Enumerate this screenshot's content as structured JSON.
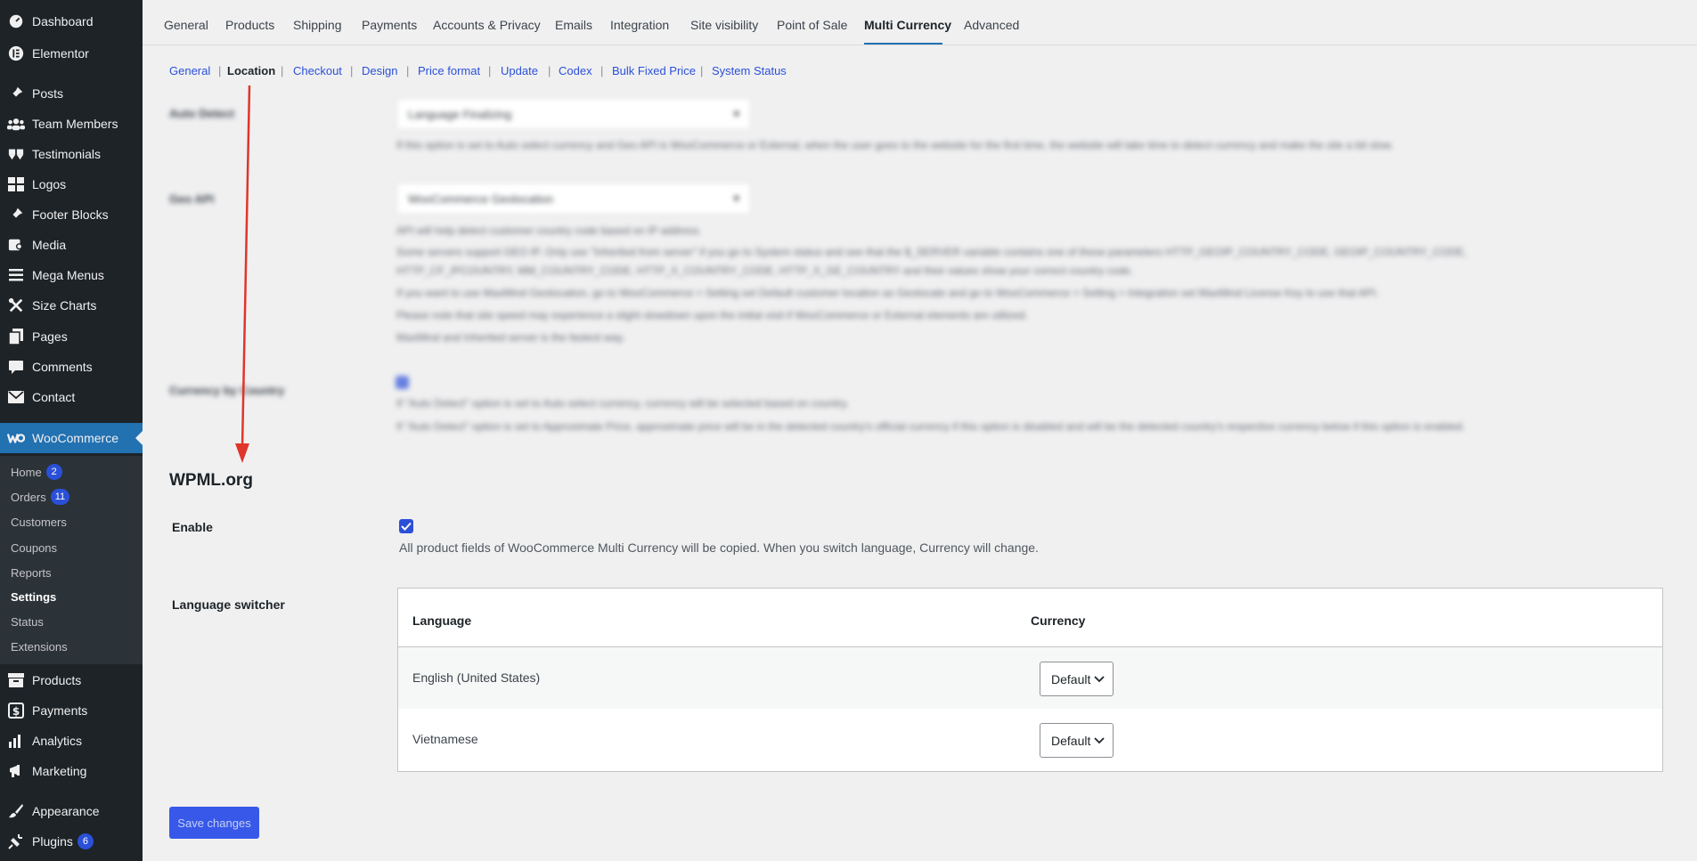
{
  "sidebar": {
    "items": [
      {
        "label": "Dashboard",
        "icon": "dashboard-icon"
      },
      {
        "label": "Elementor",
        "icon": "elementor-icon"
      },
      {
        "label": "Posts",
        "icon": "pin-icon"
      },
      {
        "label": "Team Members",
        "icon": "users-icon"
      },
      {
        "label": "Testimonials",
        "icon": "quote-icon"
      },
      {
        "label": "Logos",
        "icon": "grid-icon"
      },
      {
        "label": "Footer Blocks",
        "icon": "pin-icon"
      },
      {
        "label": "Media",
        "icon": "media-icon"
      },
      {
        "label": "Mega Menus",
        "icon": "menu-icon"
      },
      {
        "label": "Size Charts",
        "icon": "tools-icon"
      },
      {
        "label": "Pages",
        "icon": "pages-icon"
      },
      {
        "label": "Comments",
        "icon": "comment-icon"
      },
      {
        "label": "Contact",
        "icon": "mail-icon"
      },
      {
        "label": "WooCommerce",
        "icon": "woo-icon"
      },
      {
        "label": "Products",
        "icon": "archive-icon"
      },
      {
        "label": "Payments",
        "icon": "dollar-icon"
      },
      {
        "label": "Analytics",
        "icon": "chart-icon"
      },
      {
        "label": "Marketing",
        "icon": "megaphone-icon"
      },
      {
        "label": "Appearance",
        "icon": "brush-icon"
      },
      {
        "label": "Plugins",
        "icon": "plug-icon",
        "count": "6"
      }
    ],
    "submenu": [
      {
        "label": "Home",
        "count": "2"
      },
      {
        "label": "Orders",
        "count": "11"
      },
      {
        "label": "Customers"
      },
      {
        "label": "Coupons"
      },
      {
        "label": "Reports"
      },
      {
        "label": "Settings"
      },
      {
        "label": "Status"
      },
      {
        "label": "Extensions"
      }
    ]
  },
  "tabs": [
    "General",
    "Products",
    "Shipping",
    "Payments",
    "Accounts & Privacy",
    "Emails",
    "Integration",
    "Site visibility",
    "Point of Sale",
    "Multi Currency",
    "Advanced"
  ],
  "active_tab": "Multi Currency",
  "subnav": [
    "General",
    "Location",
    "Checkout",
    "Design",
    "Price format",
    "Update",
    "Codex",
    "Bulk Fixed Price",
    "System Status"
  ],
  "active_subnav": "Location",
  "blurred": {
    "auto_detect_label": "Auto Detect",
    "auto_detect_value": "Language Finalizing",
    "auto_detect_desc": "If this option is set to Auto select currency and Geo API is WooCommerce or External, when the user goes to the website for the first time, the website will take time to detect currency and make the site a bit slow.",
    "geo_api_label": "Geo API",
    "geo_api_value": "WooCommerce Geolocation",
    "geo_api_desc": [
      "API will help detect customer country code based on IP address.",
      "Some servers support GEO IP. Only use \"Inherited from server\" if you go to System status and see that the $_SERVER variable contains one of these parameters HTTP_GEOIP_COUNTRY_CODE, GEOIP_COUNTRY_CODE,",
      "HTTP_CF_IPCOUNTRY, MM_COUNTRY_CODE, HTTP_X_COUNTRY_CODE, HTTP_X_GE_COUNTRY and their values show your correct country code.",
      "If you want to use MaxMind Geolocation, go to WooCommerce > Setting set Default customer location as Geolocate and go to WooCommerce > Setting > Integration set MaxMind License Key to use that API.",
      "Please note that site speed may experience a slight slowdown upon the initial visit if WooCommerce or External elements are utilized.",
      "MaxMind and Inherited server is the fastest way."
    ],
    "currency_by_country_label": "Currency by Country",
    "currency_by_country_desc": [
      "If \"Auto Detect\" option is set to Auto select currency, currency will be selected based on country.",
      "If \"Auto Detect\" option is set to Approximate Price, approximate price will be in the detected country's official currency if this option is disabled and will be the detected country's respective currency below if this option is enabled."
    ]
  },
  "wpml": {
    "title": "WPML.org",
    "enable_label": "Enable",
    "enable_checked": true,
    "enable_desc": "All product fields of WooCommerce Multi Currency will be copied. When you switch language, Currency will change.",
    "switcher_label": "Language switcher",
    "table": {
      "headers": [
        "Language",
        "Currency"
      ],
      "rows": [
        {
          "language": "English (United States)",
          "currency": "Default"
        },
        {
          "language": "Vietnamese",
          "currency": "Default"
        }
      ]
    }
  },
  "save_label": "Save changes",
  "colors": {
    "accent": "#2b50d8",
    "annotation_arrow": "#e0352b",
    "sidebar_bg": "#1d2327",
    "active_menu": "#2271b1"
  }
}
